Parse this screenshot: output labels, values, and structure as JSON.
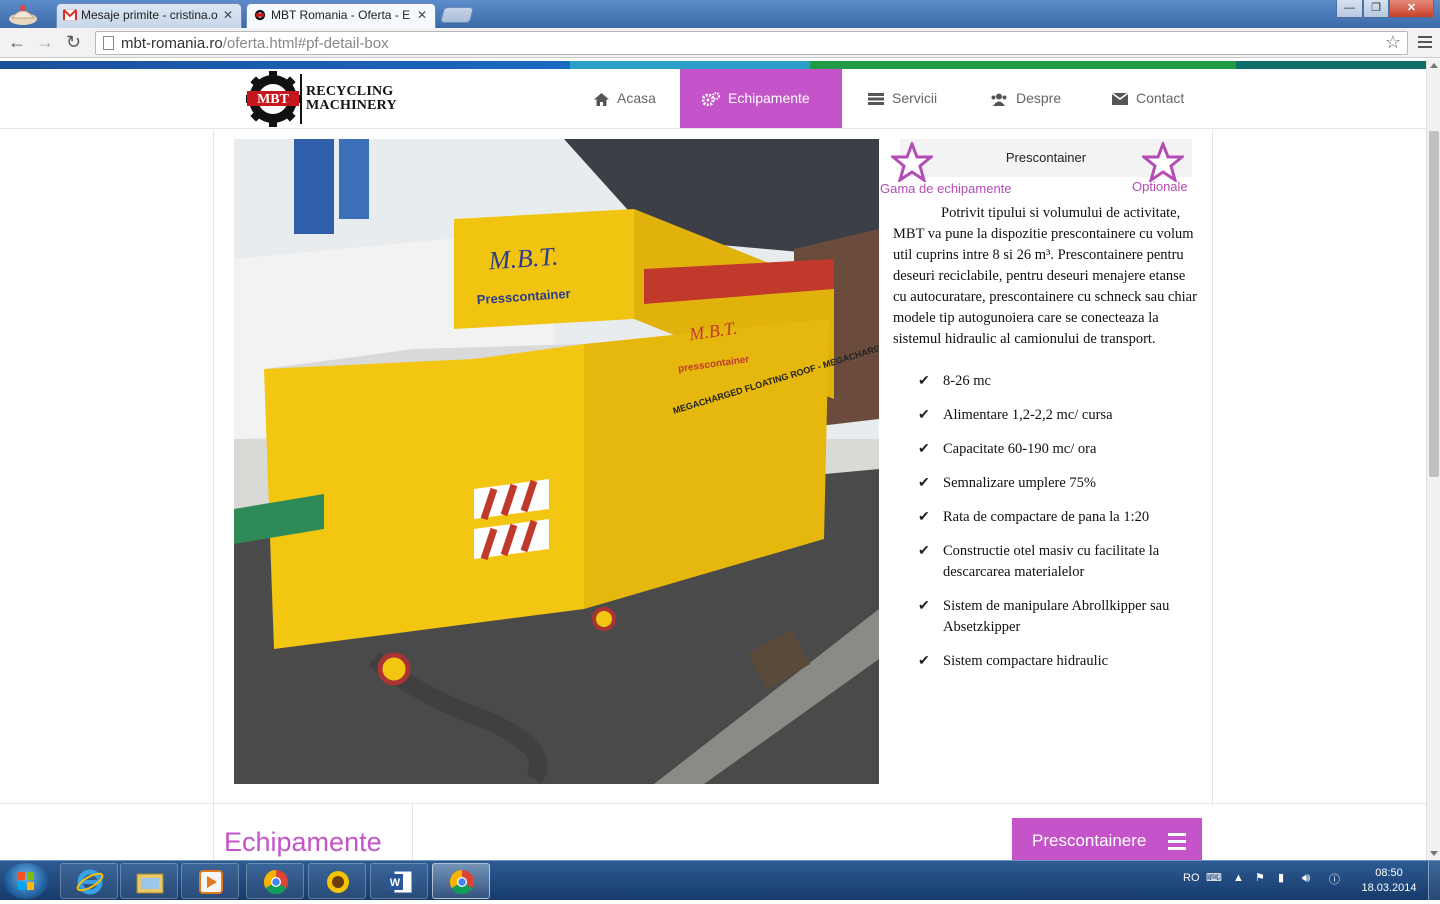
{
  "browser": {
    "tabs": [
      {
        "title": "Mesaje primite - cristina.o"
      },
      {
        "title": "MBT Romania - Oferta - E"
      }
    ],
    "address": {
      "host": "mbt-romania.ro",
      "path": "/oferta.html#pf-detail-box"
    }
  },
  "site": {
    "logo": {
      "line1": "RECYCLING",
      "line2": "MACHINERY",
      "mark_text": "MBT"
    },
    "nav": [
      {
        "label": "Acasa",
        "icon": "home-icon"
      },
      {
        "label": "Echipamente",
        "icon": "gears-icon",
        "active": true
      },
      {
        "label": "Servicii",
        "icon": "list-icon"
      },
      {
        "label": "Despre",
        "icon": "users-icon"
      },
      {
        "label": "Contact",
        "icon": "envelope-icon"
      }
    ],
    "colors": {
      "accent": "#c553c9",
      "bar": [
        "#1a5aa8",
        "#2aa0c8",
        "#1f9a47",
        "#0f6d6a"
      ]
    }
  },
  "product": {
    "tab_title": "Prescontainer",
    "left_link": "Gama de echipamente",
    "right_link": "Optionale",
    "description": "Potrivit tipului si volumului de activitate, MBT va pune la dispozitie  prescontainere cu volum util cuprins intre 8 si 26 m³. Prescontainere pentru deseuri reciclabile, pentru deseuri menajere etanse cu autocuratare, prescontainere cu schneck sau chiar modele tip autogunoiera care se conecteaza la sistemul hidraulic al camionului de transport.",
    "features": [
      "8-26 mc",
      "Alimentare 1,2-2,2 mc/ cursa",
      "Capacitate 60-190 mc/ ora",
      "Semnalizare umplere 75%",
      "Rata de compactare de pana la 1:20",
      "Constructie otel masiv cu facilitate la descarcarea materialelor",
      "Sistem de manipulare Abrollkipper sau Absetzkipper",
      "Sistem compactare hidraulic"
    ],
    "photo_text": {
      "brand": "M.B.T.",
      "model": "Presscontainer",
      "side_brand": "M.B.T.",
      "side_model": "presscontainer",
      "side_strip": "MEGACHARGED FLOATING ROOF - MEGACHARGED FLOATING ROOF"
    }
  },
  "footer_section": {
    "title": "Echipamente",
    "button_label": "Prescontainere"
  },
  "taskbar": {
    "lang": "RO",
    "time": "08:50",
    "date": "18.03.2014"
  }
}
